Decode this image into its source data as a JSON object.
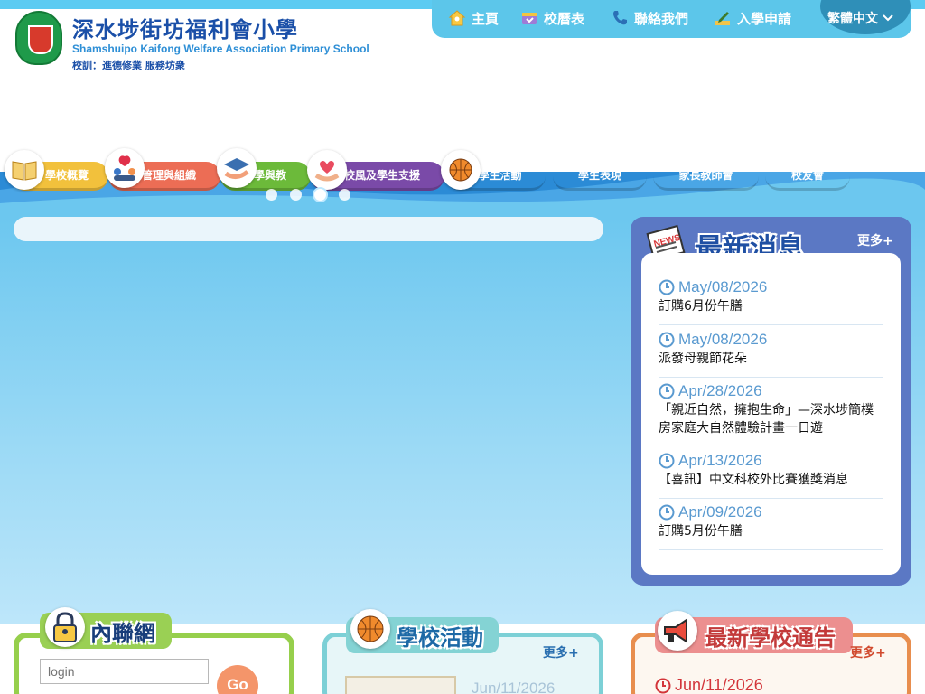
{
  "school": {
    "name_zh": "深水埗街坊福利會小學",
    "name_en": "Shamshuipo Kaifong Welfare Association Primary School",
    "motto": "校訓：進德修業 服務坊衆"
  },
  "topnav": {
    "items": [
      {
        "label": "主頁",
        "icon": "home-icon"
      },
      {
        "label": "校曆表",
        "icon": "calendar-icon"
      },
      {
        "label": "聯絡我們",
        "icon": "phone-icon"
      },
      {
        "label": "入學申請",
        "icon": "pen-icon"
      }
    ],
    "language": "繁體中文"
  },
  "mainmenu": {
    "items": [
      {
        "label": "學校概覽",
        "color": "#f2c13c",
        "icon": "book-icon"
      },
      {
        "label": "管理與組織",
        "color": "#f2904b",
        "icon": "people-icon"
      },
      {
        "label": "學與教",
        "color": "#ec6d55",
        "icon": "graduation-cap-icon"
      },
      {
        "label": "校風及學生支援",
        "color": "#8fc53f",
        "icon": "heart-hand-icon"
      },
      {
        "label": "學生活動",
        "color": "#6cba3a",
        "icon": "basketball-icon"
      },
      {
        "label": "學生表現",
        "color": "#5bc1c2"
      },
      {
        "label": "家長教師會",
        "color": "#7a4aa8"
      },
      {
        "label": "校友會",
        "color": "#f2b447"
      }
    ]
  },
  "slider": {
    "dots": 4,
    "active": 3
  },
  "news": {
    "title": "最新消息",
    "more": "更多+",
    "items": [
      {
        "date": "May/08/2026",
        "text": "訂購6月份午膳"
      },
      {
        "date": "May/08/2026",
        "text": "派發母親節花朵"
      },
      {
        "date": "Apr/28/2026",
        "text": "「親近自然，擁抱生命」—深水埗簡樸房家庭大自然體驗計畫一日遊"
      },
      {
        "date": "Apr/13/2026",
        "text": "【喜訊】中文科校外比賽獲獎消息"
      },
      {
        "date": "Apr/09/2026",
        "text": "訂購5月份午膳"
      }
    ]
  },
  "intranet": {
    "title": "內聯網",
    "login_placeholder": "login",
    "go_label": "Go"
  },
  "activities": {
    "title": "學校活動",
    "more": "更多+",
    "date": "Jun/11/2026"
  },
  "circulars": {
    "title": "最新學校通告",
    "more": "更多+",
    "date": "Jun/11/2026"
  }
}
